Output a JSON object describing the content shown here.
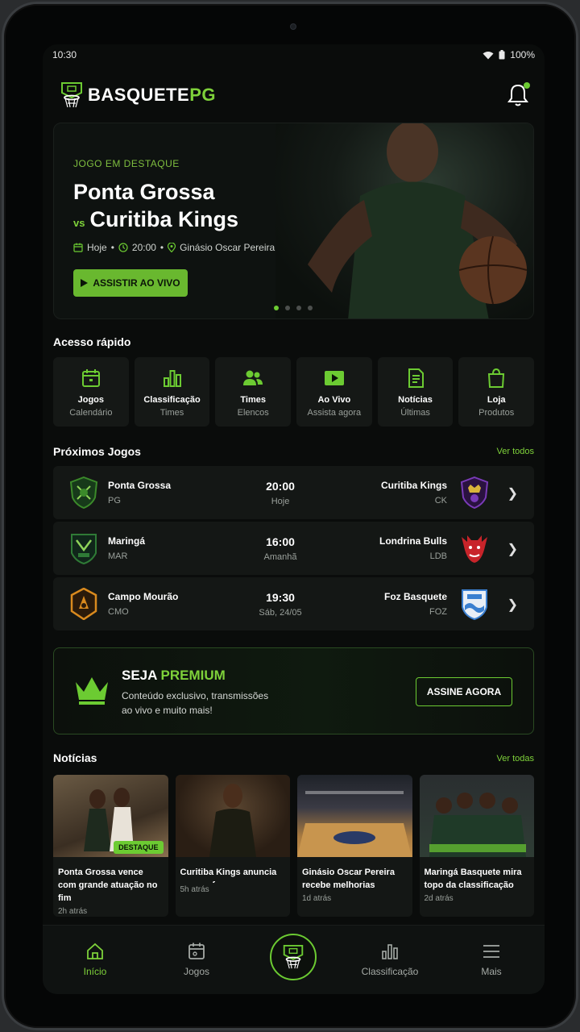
{
  "status": {
    "time": "10:30",
    "battery": "100%"
  },
  "app": {
    "logo_main": "BASQUETE",
    "logo_accent": "PG"
  },
  "hero": {
    "kicker": "JOGO EM DESTAQUE",
    "team_home": "Ponta Grossa",
    "vs": "vs",
    "team_away": "Curitiba Kings",
    "date": "Hoje",
    "time": "20:00",
    "venue": "Ginásio Oscar Pereira",
    "button": "ASSISTIR AO VIVO",
    "carousel_active": 1,
    "carousel_total": 4
  },
  "quick_access": {
    "title": "Acesso rápido",
    "items": [
      {
        "label": "Jogos",
        "sub": "Calendário",
        "icon": "calendar-icon"
      },
      {
        "label": "Classificação",
        "sub": "Times",
        "icon": "bar-chart-icon"
      },
      {
        "label": "Times",
        "sub": "Elencos",
        "icon": "users-icon"
      },
      {
        "label": "Ao Vivo",
        "sub": "Assista agora",
        "icon": "play-icon"
      },
      {
        "label": "Notícias",
        "sub": "Últimas",
        "icon": "document-icon"
      },
      {
        "label": "Loja",
        "sub": "Produtos",
        "icon": "shopping-bag-icon"
      }
    ]
  },
  "upcoming": {
    "title": "Próximos Jogos",
    "see_all": "Ver todos",
    "games": [
      {
        "home": "Ponta Grossa",
        "home_abbr": "PG",
        "time": "20:00",
        "day": "Hoje",
        "away": "Curitiba Kings",
        "away_abbr": "CK",
        "home_color": "#3b8a2a",
        "away_color": "#7a3bb8"
      },
      {
        "home": "Maringá",
        "home_abbr": "MAR",
        "time": "16:00",
        "day": "Amanhã",
        "away": "Londrina Bulls",
        "away_abbr": "LDB",
        "home_color": "#2f7a36",
        "away_color": "#c8242a"
      },
      {
        "home": "Campo Mourão",
        "home_abbr": "CMO",
        "time": "19:30",
        "day": "Sáb, 24/05",
        "away": "Foz Basquete",
        "away_abbr": "FOZ",
        "home_color": "#d98a1e",
        "away_color": "#3a7fd0"
      }
    ]
  },
  "premium": {
    "title_main": "SEJA",
    "title_accent": "PREMIUM",
    "description": "Conteúdo exclusivo, transmissões ao vivo e muito mais!",
    "button": "ASSINE AGORA"
  },
  "news": {
    "title": "Notícias",
    "see_all": "Ver todas",
    "items": [
      {
        "title": "Ponta Grossa vence com grande atuação no fim",
        "time": "2h atrás",
        "badge": "DESTAQUE",
        "tone": "#5a4a36"
      },
      {
        "title": "Curitiba Kings anuncia novo reforço para a temporada",
        "time": "5h atrás",
        "badge": "",
        "tone": "#4a3a28"
      },
      {
        "title": "Ginásio Oscar Pereira recebe melhorias",
        "time": "1d atrás",
        "badge": "",
        "tone": "#7a5a30"
      },
      {
        "title": "Maringá Basquete mira topo da classificação",
        "time": "2d atrás",
        "badge": "",
        "tone": "#3a4a40"
      }
    ]
  },
  "tabbar": {
    "items": [
      {
        "label": "Início",
        "active": true
      },
      {
        "label": "Jogos",
        "active": false
      },
      {
        "label": "Classificação",
        "active": false
      },
      {
        "label": "Mais",
        "active": false
      }
    ]
  },
  "colors": {
    "accent": "#6ccb32",
    "background": "#0a0c0b",
    "card": "#141715"
  }
}
